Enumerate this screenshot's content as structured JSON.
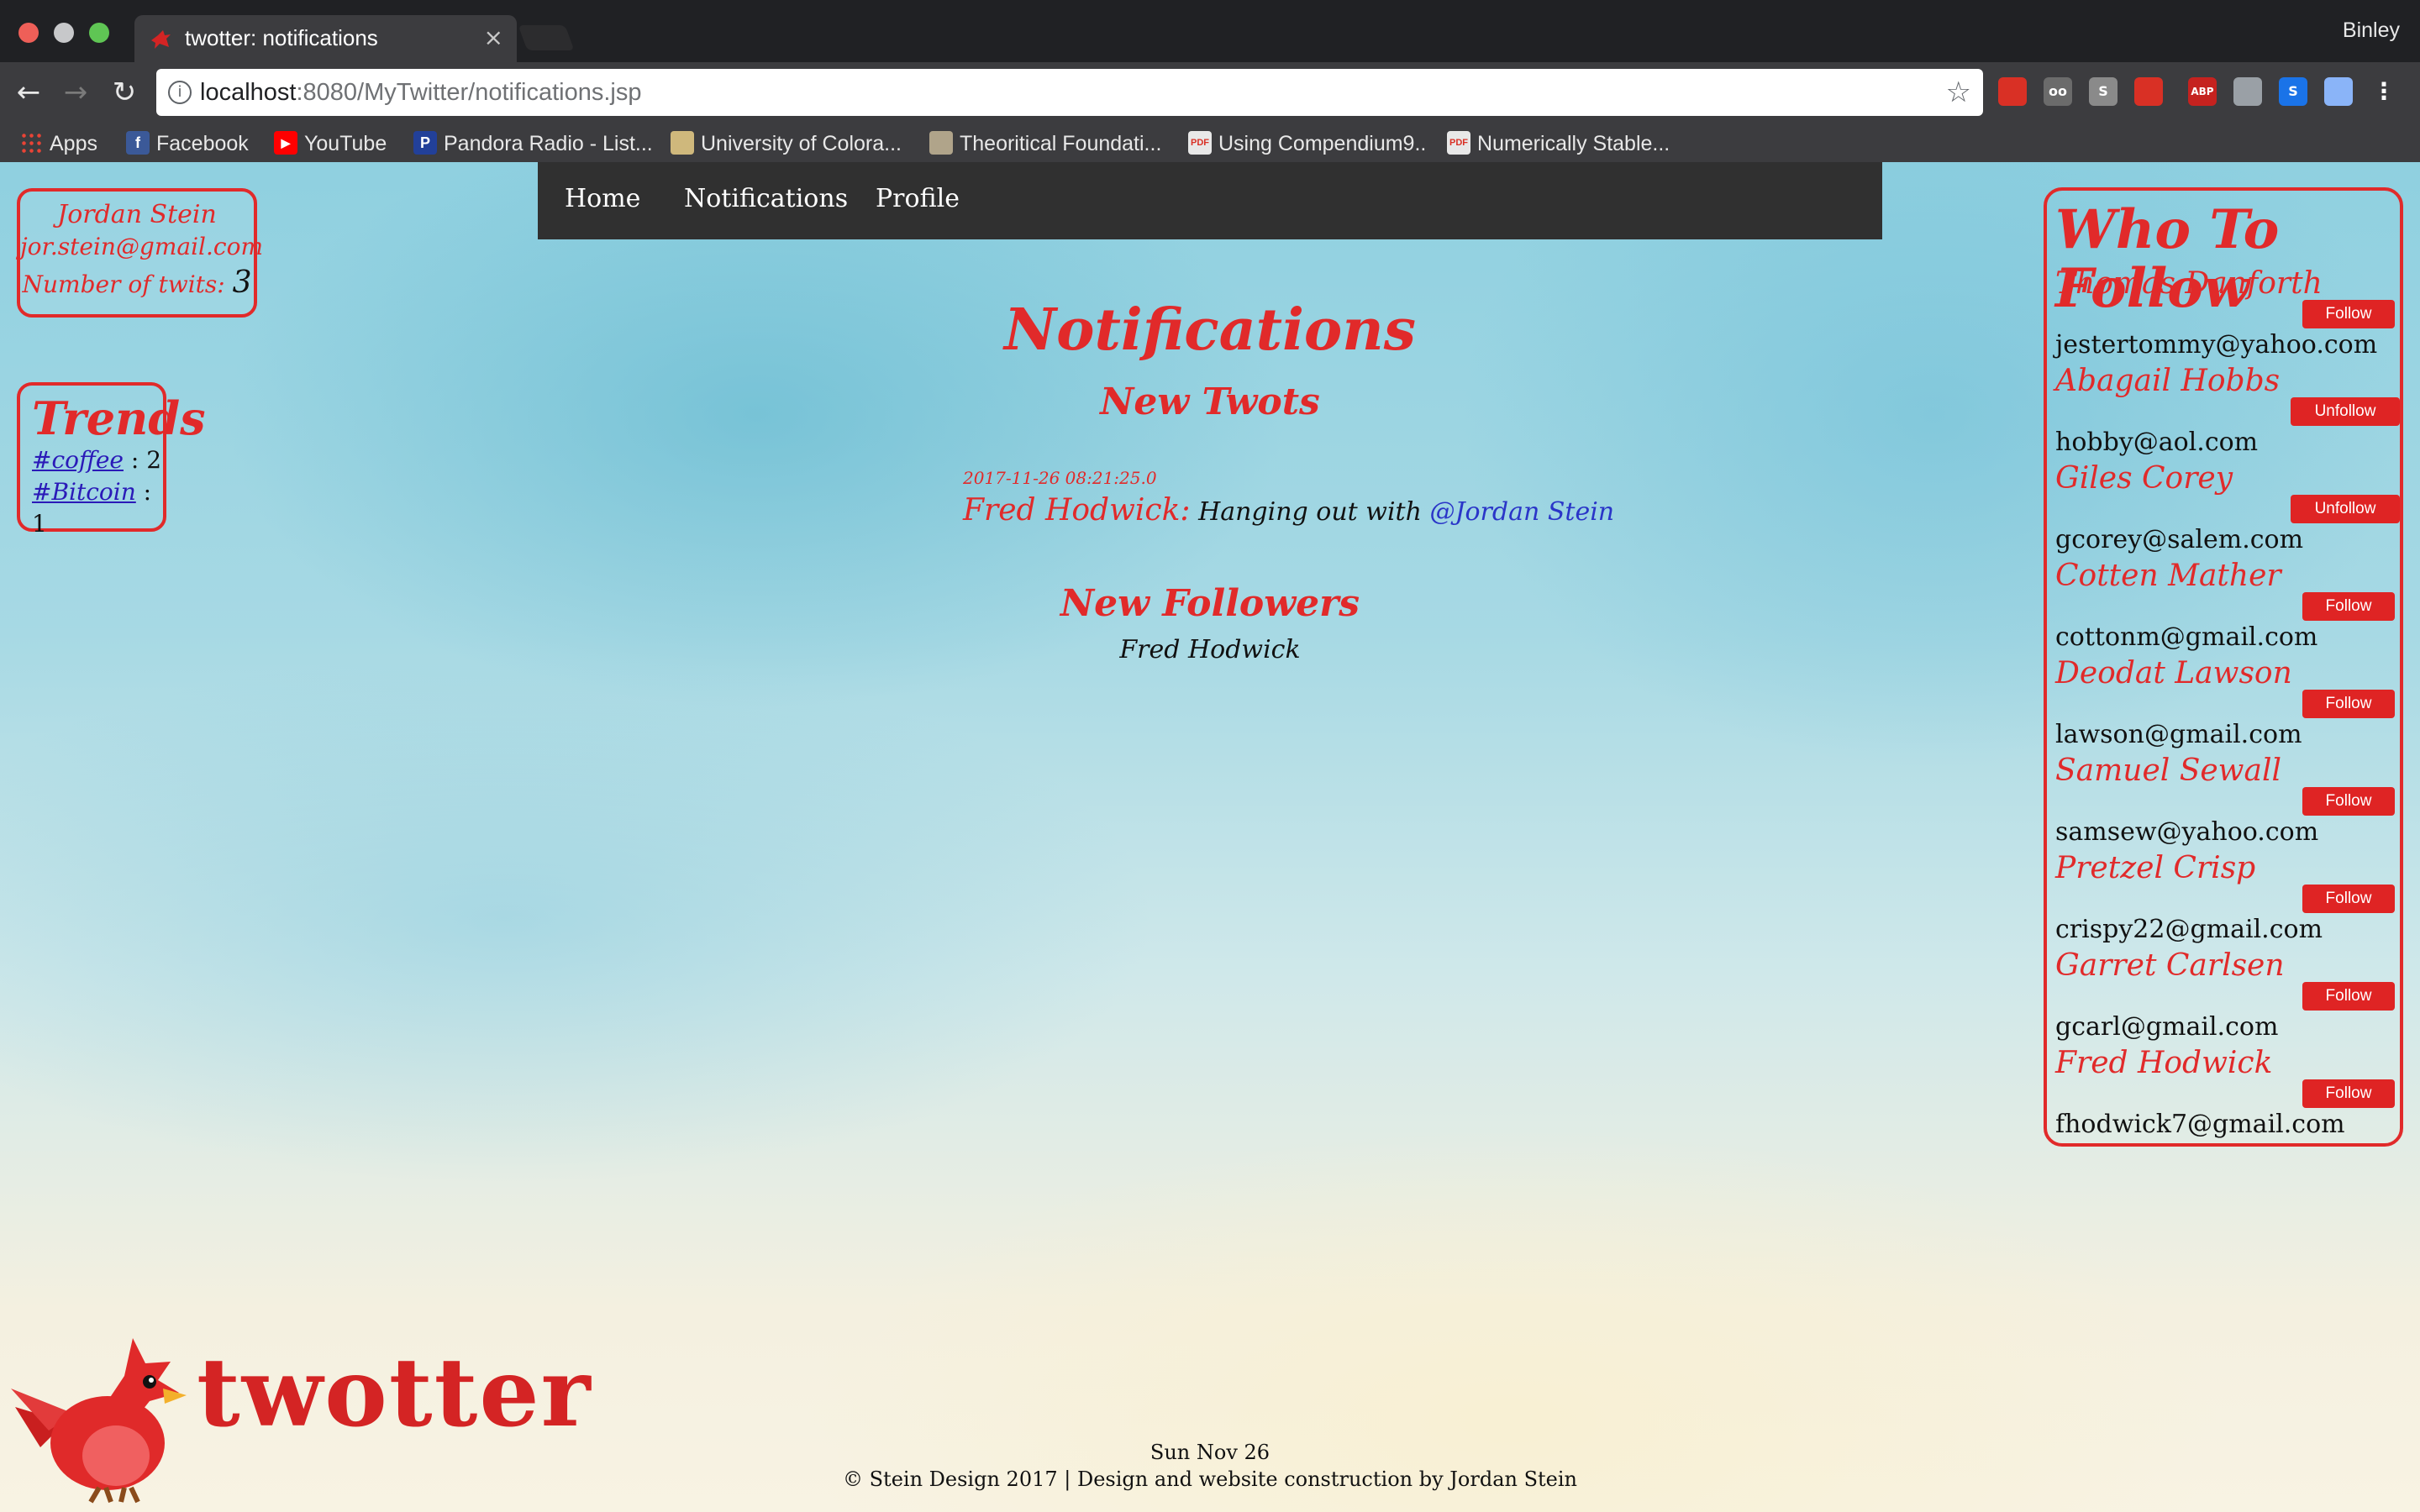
{
  "browser": {
    "tab_title": "twotter: notifications",
    "tab_close": "×",
    "profile_name": "Binley",
    "url_host": "localhost",
    "url_rest": ":8080/MyTwitter/notifications.jsp",
    "nav": {
      "back": "←",
      "forward": "→",
      "reload": "↻"
    },
    "star": "☆",
    "info": "i",
    "extensions": [
      {
        "label": "",
        "color": "#d93025"
      },
      {
        "label": "oo",
        "color": "#6b6b6b"
      },
      {
        "label": "S",
        "color": "#8a8a8a"
      },
      {
        "label": "",
        "color": "#d93025"
      },
      {
        "label": "ABP",
        "color": "#c5221f"
      },
      {
        "label": "",
        "color": "#9aa0a6"
      },
      {
        "label": "S",
        "color": "#1a73e8"
      },
      {
        "label": "",
        "color": "#8ab4f8"
      },
      {
        "label": "⋮",
        "color": "#3c3c3f"
      }
    ],
    "bookmarks": [
      {
        "label": "Apps",
        "icon": "apps-grid-icon"
      },
      {
        "label": "Facebook",
        "icon": "facebook-icon"
      },
      {
        "label": "YouTube",
        "icon": "youtube-icon"
      },
      {
        "label": "Pandora Radio - List...",
        "icon": "pandora-icon"
      },
      {
        "label": "University of Colora...",
        "icon": "university-icon"
      },
      {
        "label": "Theoritical Foundati...",
        "icon": "book-icon"
      },
      {
        "label": "Using Compendium9..",
        "icon": "pdf-icon"
      },
      {
        "label": "Numerically Stable...",
        "icon": "pdf-icon"
      }
    ]
  },
  "user": {
    "name": "Jordan Stein",
    "email": "jor.stein@gmail.com",
    "count_label": "Number of twits:",
    "count": "3"
  },
  "trends": {
    "title": "Trends",
    "items": [
      {
        "tag": "#coffee",
        "count": " : 2"
      },
      {
        "tag": "#Bitcoin",
        "count": " : 1"
      }
    ]
  },
  "nav": {
    "home": "Home",
    "notifications": "Notifications",
    "profile": "Profile"
  },
  "notifications": {
    "title": "Notifications",
    "new_twots_title": "New Twots",
    "twot": {
      "timestamp": "2017-11-26 08:21:25.0",
      "author": "Fred Hodwick:",
      "text": " Hanging out with ",
      "mention": "@Jordan Stein"
    },
    "new_followers_title": "New Followers",
    "followers": [
      "Fred Hodwick"
    ]
  },
  "who_to_follow": {
    "title": "Who To Follow",
    "users": [
      {
        "name": "Thomas Danforth",
        "email": "jestertommy@yahoo.com",
        "button": "Follow"
      },
      {
        "name": "Abagail Hobbs",
        "email": "hobby@aol.com",
        "button": "Unfollow"
      },
      {
        "name": "Giles Corey",
        "email": "gcorey@salem.com",
        "button": "Unfollow"
      },
      {
        "name": "Cotten Mather",
        "email": "cottonm@gmail.com",
        "button": "Follow"
      },
      {
        "name": "Deodat Lawson",
        "email": "lawson@gmail.com",
        "button": "Follow"
      },
      {
        "name": "Samuel Sewall",
        "email": "samsew@yahoo.com",
        "button": "Follow"
      },
      {
        "name": "Pretzel Crisp",
        "email": "crispy22@gmail.com",
        "button": "Follow"
      },
      {
        "name": "Garret Carlsen",
        "email": "gcarl@gmail.com",
        "button": "Follow"
      },
      {
        "name": "Fred Hodwick",
        "email": "fhodwick7@gmail.com",
        "button": "Follow"
      }
    ]
  },
  "logo": {
    "wordmark": "twotter"
  },
  "footer": {
    "date": "Sun Nov 26",
    "copyright": "© Stein Design 2017 | Design and website construction by Jordan Stein"
  },
  "colors": {
    "accent": "#e12a2a",
    "nav_bg": "#303030",
    "mention": "#2a35c8"
  }
}
